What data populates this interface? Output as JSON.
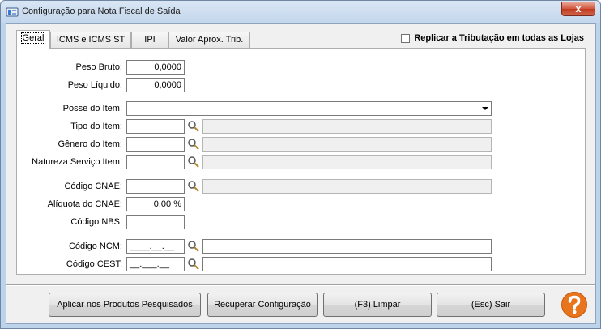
{
  "window": {
    "title": "Configuração para Nota Fiscal de Saída",
    "close_label": "x"
  },
  "tabs": [
    {
      "label": "Geral",
      "active": true
    },
    {
      "label": "ICMS e ICMS ST",
      "active": false
    },
    {
      "label": "IPI",
      "active": false
    },
    {
      "label": "Valor Aprox. Trib.",
      "active": false
    }
  ],
  "replicar": {
    "label": "Replicar a Tributação em todas as Lojas",
    "checked": false
  },
  "form": {
    "peso_bruto": {
      "label": "Peso Bruto:",
      "value": "0,0000"
    },
    "peso_liquido": {
      "label": "Peso Líquido:",
      "value": "0,0000"
    },
    "posse_item": {
      "label": "Posse do Item:",
      "value": ""
    },
    "tipo_item": {
      "label": "Tipo do Item:",
      "value": "",
      "desc": ""
    },
    "genero_item": {
      "label": "Gênero do Item:",
      "value": "",
      "desc": ""
    },
    "natureza_servico": {
      "label": "Natureza Serviço Item:",
      "value": "",
      "desc": ""
    },
    "codigo_cnae": {
      "label": "Código CNAE:",
      "value": "",
      "desc": ""
    },
    "aliquota_cnae": {
      "label": "Alíquota do CNAE:",
      "value": "0,00 %"
    },
    "codigo_nbs": {
      "label": "Código NBS:",
      "value": ""
    },
    "codigo_ncm": {
      "label": "Código NCM:",
      "value": "____.__.__",
      "desc": ""
    },
    "codigo_cest": {
      "label": "Código CEST:",
      "value": "__.___.__",
      "desc": ""
    }
  },
  "buttons": {
    "aplicar": "Aplicar nos Produtos Pesquisados",
    "recuperar": "Recuperar Configuração",
    "limpar": "(F3) Limpar",
    "sair": "(Esc) Sair"
  },
  "icons": {
    "search": "magnifier-icon",
    "help": "help-icon",
    "help_color": "#e8741c"
  }
}
